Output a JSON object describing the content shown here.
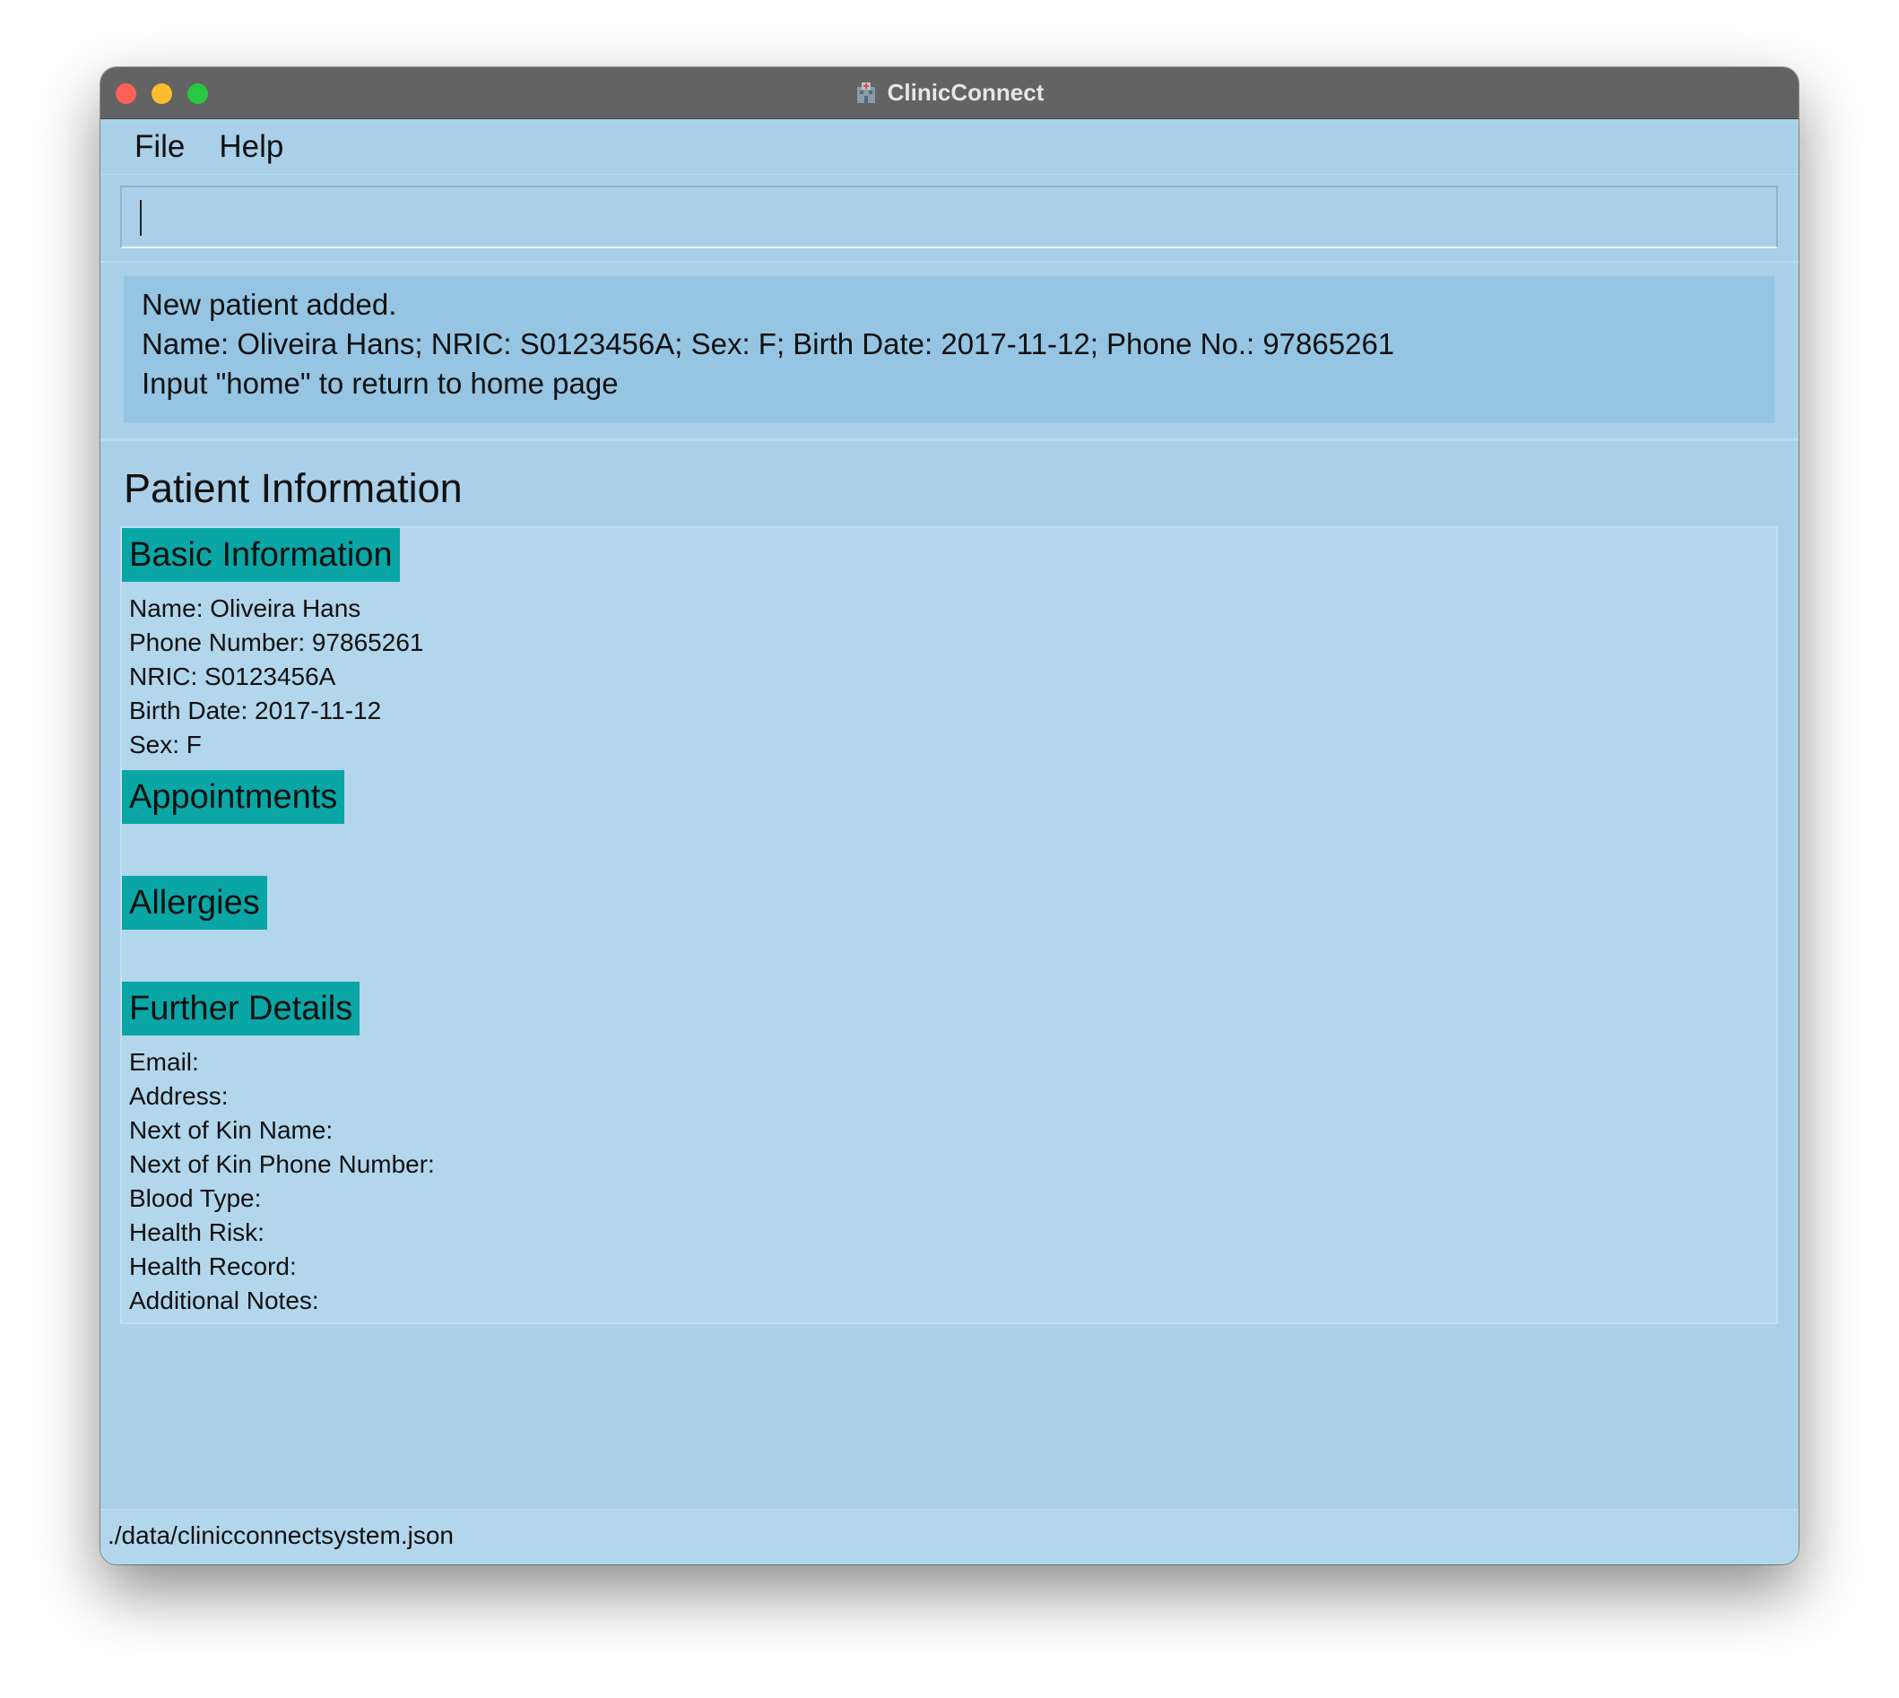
{
  "window": {
    "title": "ClinicConnect",
    "icon": "hospital-icon"
  },
  "menu": {
    "file": "File",
    "help": "Help"
  },
  "command": {
    "value": "",
    "placeholder": ""
  },
  "result": {
    "line1": "New patient added.",
    "line2": "Name: Oliveira Hans; NRIC: S0123456A; Sex: F; Birth Date: 2017-11-12; Phone No.: 97865261",
    "line3": "Input \"home\" to return to home page"
  },
  "patient": {
    "heading": "Patient Information",
    "basic": {
      "header": "Basic Information",
      "name": "Name: Oliveira Hans",
      "phone": "Phone Number: 97865261",
      "nric": "NRIC: S0123456A",
      "birth_date": "Birth Date: 2017-11-12",
      "sex": "Sex: F"
    },
    "appointments": {
      "header": "Appointments"
    },
    "allergies": {
      "header": "Allergies"
    },
    "further": {
      "header": "Further Details",
      "email": "Email:",
      "address": "Address:",
      "nok_name": "Next of Kin Name:",
      "nok_phone": "Next of Kin Phone Number:",
      "blood_type": "Blood Type:",
      "health_risk": "Health Risk:",
      "health_record": "Health Record:",
      "notes": "Additional Notes:"
    }
  },
  "status": {
    "path": "./data/clinicconnectsystem.json"
  },
  "colors": {
    "background": "#a9d0e8",
    "titlebar": "#636363",
    "result_box": "#95c5e3",
    "panel": "#b2d6ec",
    "section_header": "#0aa6a6"
  }
}
